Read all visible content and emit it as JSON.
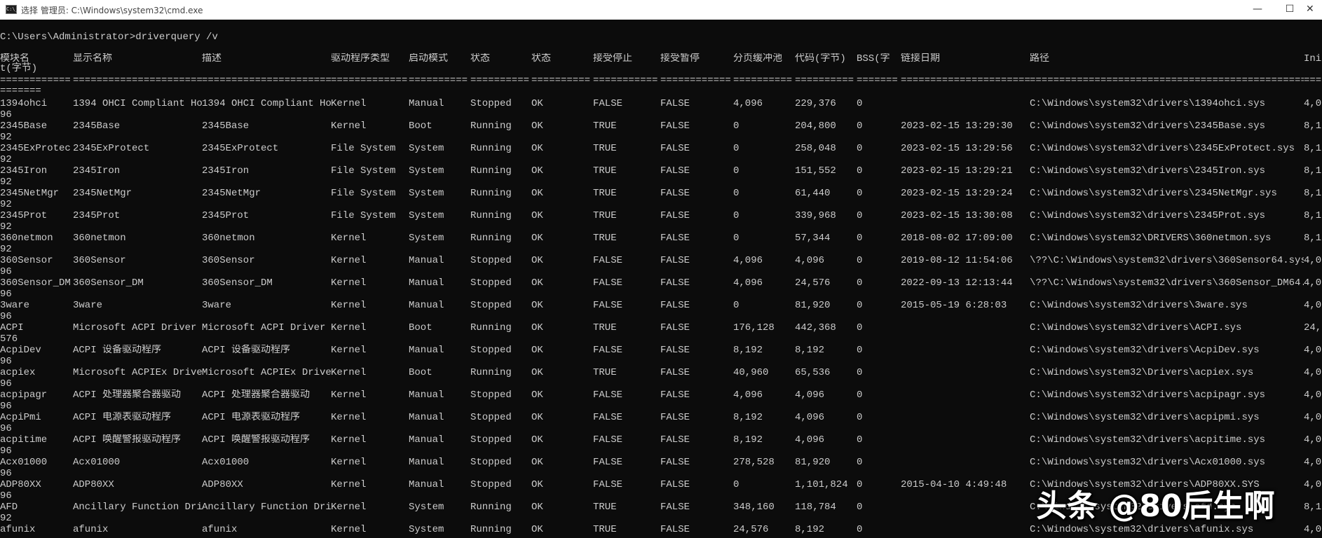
{
  "window": {
    "title": "选择 管理员: C:\\Windows\\system32\\cmd.exe",
    "icon_text": "C:\\_",
    "minimize": "—",
    "maximize": "☐",
    "close": "✕"
  },
  "console": {
    "prompt": "C:\\Users\\Administrator>driverquery /v",
    "headers": [
      "模块名",
      "显示名称",
      "描述",
      "驱动程序类型",
      "启动模式",
      "状态",
      "状态",
      "接受停止",
      "接受暂停",
      "分页缓冲池",
      "代码(字节)",
      "BSS(字",
      "链接日期",
      "路径",
      "Ini"
    ],
    "header_wrap": "t(字节)",
    "separators": [
      "============",
      "======================",
      "======================",
      "=============",
      "==========",
      "==========",
      "==========",
      "===========",
      "============",
      "==========",
      "==========",
      "=======",
      "======================",
      "================================================",
      "======"
    ],
    "separator_wrap": "=======",
    "rows": [
      [
        "1394ohci",
        "1394 OHCI Compliant Ho",
        "1394 OHCI Compliant Ho",
        "Kernel",
        "Manual",
        "Stopped",
        "OK",
        "FALSE",
        "FALSE",
        "4,096",
        "229,376",
        "0",
        "",
        "C:\\Windows\\system32\\drivers\\1394ohci.sys",
        "4,0",
        "96"
      ],
      [
        "2345Base",
        "2345Base",
        "2345Base",
        "Kernel",
        "Boot",
        "Running",
        "OK",
        "TRUE",
        "FALSE",
        "0",
        "204,800",
        "0",
        "2023-02-15 13:29:30",
        "C:\\Windows\\system32\\drivers\\2345Base.sys",
        "8,1",
        "92"
      ],
      [
        "2345ExProtec",
        "2345ExProtect",
        "2345ExProtect",
        "File System",
        "System",
        "Running",
        "OK",
        "TRUE",
        "FALSE",
        "0",
        "258,048",
        "0",
        "2023-02-15 13:29:56",
        "C:\\Windows\\system32\\drivers\\2345ExProtect.sys",
        "8,1",
        "92"
      ],
      [
        "2345Iron",
        "2345Iron",
        "2345Iron",
        "File System",
        "System",
        "Running",
        "OK",
        "TRUE",
        "FALSE",
        "0",
        "151,552",
        "0",
        "2023-02-15 13:29:21",
        "C:\\Windows\\system32\\drivers\\2345Iron.sys",
        "8,1",
        "92"
      ],
      [
        "2345NetMgr",
        "2345NetMgr",
        "2345NetMgr",
        "File System",
        "System",
        "Running",
        "OK",
        "TRUE",
        "FALSE",
        "0",
        "61,440",
        "0",
        "2023-02-15 13:29:24",
        "C:\\Windows\\system32\\drivers\\2345NetMgr.sys",
        "8,1",
        "92"
      ],
      [
        "2345Prot",
        "2345Prot",
        "2345Prot",
        "File System",
        "System",
        "Running",
        "OK",
        "TRUE",
        "FALSE",
        "0",
        "339,968",
        "0",
        "2023-02-15 13:30:08",
        "C:\\Windows\\system32\\drivers\\2345Prot.sys",
        "8,1",
        "92"
      ],
      [
        "360netmon",
        "360netmon",
        "360netmon",
        "Kernel",
        "System",
        "Running",
        "OK",
        "TRUE",
        "FALSE",
        "0",
        "57,344",
        "0",
        "2018-08-02 17:09:00",
        "C:\\Windows\\system32\\DRIVERS\\360netmon.sys",
        "8,1",
        "92"
      ],
      [
        "360Sensor",
        "360Sensor",
        "360Sensor",
        "Kernel",
        "Manual",
        "Stopped",
        "OK",
        "FALSE",
        "FALSE",
        "4,096",
        "4,096",
        "0",
        "2019-08-12 11:54:06",
        "\\??\\C:\\Windows\\system32\\drivers\\360Sensor64.sys",
        "4,0",
        "96"
      ],
      [
        "360Sensor_DM",
        "360Sensor_DM",
        "360Sensor_DM",
        "Kernel",
        "Manual",
        "Stopped",
        "OK",
        "FALSE",
        "FALSE",
        "4,096",
        "24,576",
        "0",
        "2022-09-13 12:13:44",
        "\\??\\C:\\Windows\\system32\\drivers\\360Sensor_DM64.s",
        "4,0",
        "96"
      ],
      [
        "3ware",
        "3ware",
        "3ware",
        "Kernel",
        "Manual",
        "Stopped",
        "OK",
        "FALSE",
        "FALSE",
        "0",
        "81,920",
        "0",
        "2015-05-19 6:28:03",
        "C:\\Windows\\system32\\drivers\\3ware.sys",
        "4,0",
        "96"
      ],
      [
        "ACPI",
        "Microsoft ACPI Driver",
        "Microsoft ACPI Driver",
        "Kernel",
        "Boot",
        "Running",
        "OK",
        "TRUE",
        "FALSE",
        "176,128",
        "442,368",
        "0",
        "",
        "C:\\Windows\\system32\\drivers\\ACPI.sys",
        "24,5",
        "576"
      ],
      [
        "AcpiDev",
        "ACPI 设备驱动程序",
        "ACPI 设备驱动程序",
        "Kernel",
        "Manual",
        "Stopped",
        "OK",
        "FALSE",
        "FALSE",
        "8,192",
        "8,192",
        "0",
        "",
        "C:\\Windows\\system32\\drivers\\AcpiDev.sys",
        "4,0",
        "96"
      ],
      [
        "acpiex",
        "Microsoft ACPIEx Drive",
        "Microsoft ACPIEx Drive",
        "Kernel",
        "Boot",
        "Running",
        "OK",
        "TRUE",
        "FALSE",
        "40,960",
        "65,536",
        "0",
        "",
        "C:\\Windows\\system32\\Drivers\\acpiex.sys",
        "4,0",
        "96"
      ],
      [
        "acpipagr",
        "ACPI 处理器聚合器驱动",
        "ACPI 处理器聚合器驱动",
        "Kernel",
        "Manual",
        "Stopped",
        "OK",
        "FALSE",
        "FALSE",
        "4,096",
        "4,096",
        "0",
        "",
        "C:\\Windows\\system32\\drivers\\acpipagr.sys",
        "4,0",
        "96"
      ],
      [
        "AcpiPmi",
        "ACPI 电源表驱动程序",
        "ACPI 电源表驱动程序",
        "Kernel",
        "Manual",
        "Stopped",
        "OK",
        "FALSE",
        "FALSE",
        "8,192",
        "4,096",
        "0",
        "",
        "C:\\Windows\\system32\\drivers\\acpipmi.sys",
        "4,0",
        "96"
      ],
      [
        "acpitime",
        "ACPI 唤醒警报驱动程序",
        "ACPI 唤醒警报驱动程序",
        "Kernel",
        "Manual",
        "Stopped",
        "OK",
        "FALSE",
        "FALSE",
        "8,192",
        "4,096",
        "0",
        "",
        "C:\\Windows\\system32\\drivers\\acpitime.sys",
        "4,0",
        "96"
      ],
      [
        "Acx01000",
        "Acx01000",
        "Acx01000",
        "Kernel",
        "Manual",
        "Stopped",
        "OK",
        "FALSE",
        "FALSE",
        "278,528",
        "81,920",
        "0",
        "",
        "C:\\Windows\\system32\\drivers\\Acx01000.sys",
        "4,0",
        "96"
      ],
      [
        "ADP80XX",
        "ADP80XX",
        "ADP80XX",
        "Kernel",
        "Manual",
        "Stopped",
        "OK",
        "FALSE",
        "FALSE",
        "0",
        "1,101,824",
        "0",
        "2015-04-10 4:49:48",
        "C:\\Windows\\system32\\drivers\\ADP80XX.SYS",
        "4,0",
        "96"
      ],
      [
        "AFD",
        "Ancillary Function Dri",
        "Ancillary Function Dri",
        "Kernel",
        "System",
        "Running",
        "OK",
        "TRUE",
        "FALSE",
        "348,160",
        "118,784",
        "0",
        "",
        "C:\\Windows\\system32\\drivers\\afd.sys",
        "8,1",
        "92"
      ],
      [
        "afunix",
        "afunix",
        "afunix",
        "Kernel",
        "System",
        "Running",
        "OK",
        "TRUE",
        "FALSE",
        "24,576",
        "8,192",
        "0",
        "",
        "C:\\Windows\\system32\\drivers\\afunix.sys",
        "4,0",
        ""
      ]
    ]
  },
  "watermark": "头条 @80后生啊"
}
